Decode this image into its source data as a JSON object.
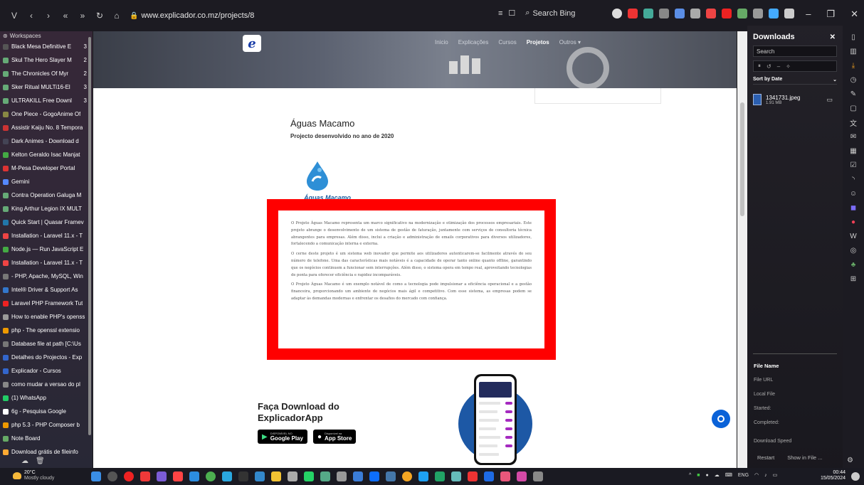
{
  "browser": {
    "url": "www.explicador.co.mz/projects/8",
    "search_placeholder": "Search Bing"
  },
  "sidebar": {
    "workspace": "Workspaces",
    "tabs": [
      {
        "label": "Black Mesa Definitive E",
        "count": "3",
        "color": "#555"
      },
      {
        "label": "Skul The Hero Slayer M",
        "count": "2",
        "color": "#6a7"
      },
      {
        "label": "The Chronicles Of Myr",
        "count": "2",
        "color": "#6a7"
      },
      {
        "label": "Sker Ritual MULTi16-El",
        "count": "3",
        "color": "#6a7"
      },
      {
        "label": "ULTRAKILL Free Downl",
        "count": "3",
        "color": "#6a7"
      },
      {
        "label": "One Piece - GogoAnime Of",
        "count": "",
        "color": "#884"
      },
      {
        "label": "Assistir Kaiju No. 8 Tempora",
        "count": "",
        "color": "#c33"
      },
      {
        "label": "Dark Animes - Download d",
        "count": "",
        "color": "#445"
      },
      {
        "label": "Kelton Geraldo Isac Manjat",
        "count": "",
        "color": "#4a4"
      },
      {
        "label": "M-Pesa Developer Portal",
        "count": "",
        "color": "#d33"
      },
      {
        "label": "Gemini",
        "count": "",
        "color": "#58f"
      },
      {
        "label": "Contra Operation Galuga M",
        "count": "",
        "color": "#6a7"
      },
      {
        "label": "King Arthur Legion IX MULT",
        "count": "",
        "color": "#6a7"
      },
      {
        "label": "Quick Start | Quasar Framev",
        "count": "",
        "color": "#27a"
      },
      {
        "label": "Installation - Laravel 11.x - T",
        "count": "",
        "color": "#e44"
      },
      {
        "label": "Node.js — Run JavaScript E",
        "count": "",
        "color": "#4a4"
      },
      {
        "label": "Installation - Laravel 11.x - T",
        "count": "",
        "color": "#e44"
      },
      {
        "label": "- PHP, Apache, MySQL, Win",
        "count": "",
        "color": "#777"
      },
      {
        "label": "Intel® Driver & Support As",
        "count": "",
        "color": "#37c"
      },
      {
        "label": "Laravel PHP Framework Tut",
        "count": "",
        "color": "#e22"
      },
      {
        "label": "How to enable PHP's openss",
        "count": "",
        "color": "#999"
      },
      {
        "label": "php - The openssl extensio",
        "count": "",
        "color": "#e90"
      },
      {
        "label": "Database file at path [C:\\Us",
        "count": "",
        "color": "#777"
      },
      {
        "label": "Detalhes do Projectos - Exp",
        "count": "",
        "color": "#36c"
      },
      {
        "label": "Explicador - Cursos",
        "count": "",
        "color": "#36c"
      },
      {
        "label": "como mudar a versao do pl",
        "count": "",
        "color": "#888"
      },
      {
        "label": "(1) WhatsApp",
        "count": "",
        "color": "#2c6"
      },
      {
        "label": "6g - Pesquisa Google",
        "count": "",
        "color": "#fff"
      },
      {
        "label": "php 5.3 - PHP Composer b",
        "count": "",
        "color": "#e90"
      },
      {
        "label": "Note Board",
        "count": "",
        "color": "#6a6"
      },
      {
        "label": "Download grátis de fileinfo",
        "count": "",
        "color": "#fa3"
      }
    ]
  },
  "site": {
    "logo": "e",
    "nav": [
      "Inicio",
      "Explicações",
      "Cursos",
      "Projetos",
      "Outros ▾"
    ],
    "active_nav": "Projetos",
    "project_title": "Águas Macamo",
    "project_subtitle": "Projecto desenvolvido no ano de 2020",
    "logo_caption": "Águas Macamo",
    "paragraphs": [
      "O Projeto Águas Macamo representa um marco significativo na modernização e otimização dos processos empresariais. Este projeto abrange o desenvolvimento de um sistema de gestão de faturação, juntamente com serviços de consultoria técnica abrangentes para empresas. Além disso, inclui a criação e administração de emails corporativos para diversos utilizadores, fortalecendo a comunicação interna e externa.",
      "O cerne deste projeto é um sistema web inovador que permite aos utilizadores autenticarem-se facilmente através do seu número de telefone. Uma das características mais notáveis é a capacidade de operar tanto online quanto offline, garantindo que os negócios continuem a funcionar sem interrupções. Além disso, o sistema opera em tempo real, aproveitando tecnologias de ponta para oferecer eficiência e rapidez incomparáveis.",
      "O Projeto Águas Macamo é um exemplo notável de como a tecnologia pode impulsionar a eficiência operacional e a gestão financeira, proporcionando um ambiente de negócios mais ágil e competitivo. Com esse sistema, as empresas podem se adaptar às demandas modernas e enfrentar os desafios do mercado com confiança."
    ],
    "download_title": "Faça Download do ExplicadorApp",
    "google_small": "DISPONÍVEL NO",
    "google_big": "Google Play",
    "apple_small": "Disponível na",
    "apple_big": "App Store"
  },
  "downloads": {
    "title": "Downloads",
    "search_placeholder": "Search",
    "sort_label": "Sort by Date",
    "file_name": "1341731.jpeg",
    "file_size": "1.91 MB",
    "details": {
      "file_name": "File Name",
      "file_url": "File URL",
      "local_file": "Local File",
      "started": "Started:",
      "completed": "Completed:",
      "speed": "Download Speed"
    },
    "restart": "Restart",
    "show_in_file": "Show in File ..."
  },
  "taskbar": {
    "temp": "20°C",
    "weather": "Mostly cloudy",
    "lang": "ENG",
    "time": "00:44",
    "date": "15/05/2024"
  }
}
